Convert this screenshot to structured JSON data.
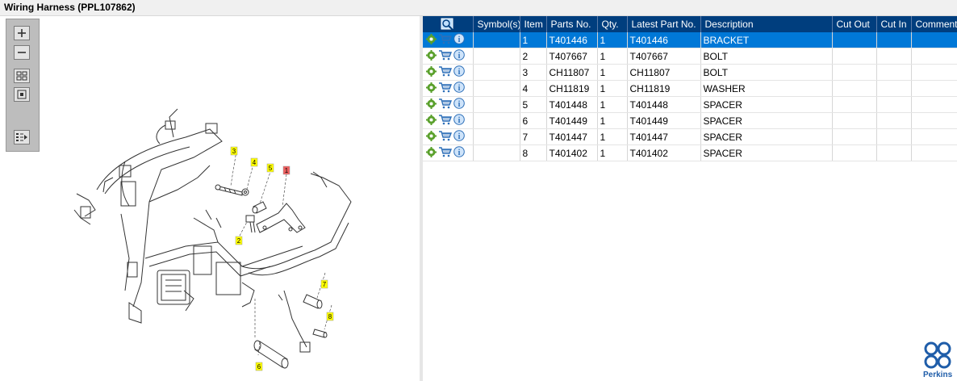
{
  "window": {
    "title": "Wiring Harness (PPL107862)"
  },
  "toolbar": {
    "buttons": [
      {
        "icon": "zoom-in-icon"
      },
      {
        "icon": "zoom-out-icon"
      },
      {
        "icon": "fit-page-icon"
      },
      {
        "icon": "actual-size-icon"
      },
      {
        "icon": "list-export-icon"
      }
    ]
  },
  "diagram": {
    "callouts": [
      {
        "label": "1",
        "color": "#f06060"
      },
      {
        "label": "2",
        "color": "#ffff00"
      },
      {
        "label": "3",
        "color": "#ffff00"
      },
      {
        "label": "4",
        "color": "#ffff00"
      },
      {
        "label": "5",
        "color": "#ffff00"
      },
      {
        "label": "6",
        "color": "#ffff00"
      },
      {
        "label": "7",
        "color": "#ffff00"
      },
      {
        "label": "8",
        "color": "#ffff00"
      }
    ]
  },
  "table": {
    "header_icon": "search-view-icon",
    "columns": [
      "Symbol(s)",
      "Item",
      "Parts No.",
      "Qty.",
      "Latest Part No.",
      "Description",
      "Cut Out",
      "Cut In",
      "Comment"
    ],
    "rows": [
      {
        "symbols": "",
        "item": "1",
        "part_no": "T401446",
        "qty": "1",
        "latest": "T401446",
        "desc": "BRACKET",
        "cut_out": "",
        "cut_in": "",
        "comment": "",
        "selected": true
      },
      {
        "symbols": "",
        "item": "2",
        "part_no": "T407667",
        "qty": "1",
        "latest": "T407667",
        "desc": "BOLT",
        "cut_out": "",
        "cut_in": "",
        "comment": "",
        "selected": false
      },
      {
        "symbols": "",
        "item": "3",
        "part_no": "CH11807",
        "qty": "1",
        "latest": "CH11807",
        "desc": "BOLT",
        "cut_out": "",
        "cut_in": "",
        "comment": "",
        "selected": false
      },
      {
        "symbols": "",
        "item": "4",
        "part_no": "CH11819",
        "qty": "1",
        "latest": "CH11819",
        "desc": "WASHER",
        "cut_out": "",
        "cut_in": "",
        "comment": "",
        "selected": false
      },
      {
        "symbols": "",
        "item": "5",
        "part_no": "T401448",
        "qty": "1",
        "latest": "T401448",
        "desc": "SPACER",
        "cut_out": "",
        "cut_in": "",
        "comment": "",
        "selected": false
      },
      {
        "symbols": "",
        "item": "6",
        "part_no": "T401449",
        "qty": "1",
        "latest": "T401449",
        "desc": "SPACER",
        "cut_out": "",
        "cut_in": "",
        "comment": "",
        "selected": false
      },
      {
        "symbols": "",
        "item": "7",
        "part_no": "T401447",
        "qty": "1",
        "latest": "T401447",
        "desc": "SPACER",
        "cut_out": "",
        "cut_in": "",
        "comment": "",
        "selected": false
      },
      {
        "symbols": "",
        "item": "8",
        "part_no": "T401402",
        "qty": "1",
        "latest": "T401402",
        "desc": "SPACER",
        "cut_out": "",
        "cut_in": "",
        "comment": "",
        "selected": false
      }
    ],
    "row_actions": [
      "gear-icon",
      "cart-icon",
      "info-icon"
    ]
  },
  "brand": {
    "name": "Perkins",
    "color": "#1f5da9"
  },
  "colors": {
    "header_bg": "#003e7e",
    "selected_row": "#0078d7",
    "callout_yellow": "#ffff00",
    "callout_red": "#f06060"
  }
}
